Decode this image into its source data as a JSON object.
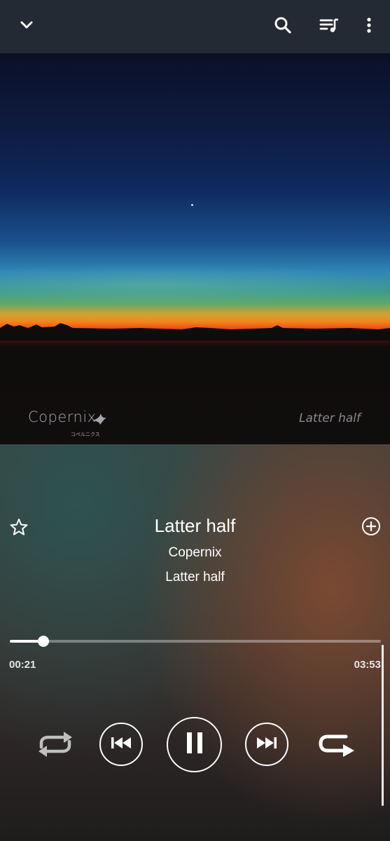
{
  "topbar": {
    "collapse_icon": "chevron-down-icon",
    "search_icon": "search-icon",
    "queue_icon": "queue-music-icon",
    "more_icon": "more-vert-icon"
  },
  "album_art": {
    "brand_text": "Copernix",
    "brand_subtext": "コペルニクス",
    "track_text": "Latter half"
  },
  "now_playing": {
    "title": "Latter half",
    "artist": "Copernix",
    "album": "Latter half",
    "favorite_icon": "star-outline-icon",
    "add_icon": "add-circle-icon"
  },
  "progress": {
    "elapsed": "00:21",
    "total": "03:53",
    "fraction": 0.09
  },
  "controls": {
    "shuffle_icon": "shuffle-icon",
    "previous_icon": "skip-previous-icon",
    "play_pause_icon": "pause-icon",
    "next_icon": "skip-next-icon",
    "repeat_icon": "repeat-icon"
  },
  "colors": {
    "topbar": "#242a33",
    "accent": "#ffffff"
  }
}
